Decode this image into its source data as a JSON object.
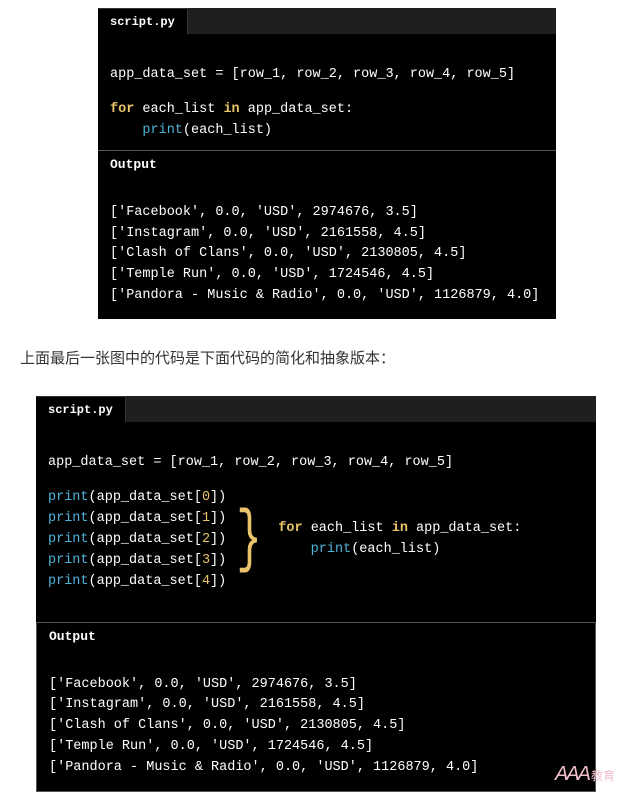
{
  "script_tab": "script.py",
  "assign_line": "app_data_set = [row_1, row_2, row_3, row_4, row_5]",
  "for_kw": "for",
  "in_kw": "in",
  "loop_var": "each_list",
  "loop_iter": "app_data_set:",
  "print_fn": "print",
  "loop_body_arg": "(each_list)",
  "output_label": "Output",
  "output_lines": [
    "['Facebook', 0.0, 'USD', 2974676, 3.5]",
    "['Instagram', 0.0, 'USD', 2161558, 4.5]",
    "['Clash of Clans', 0.0, 'USD', 2130805, 4.5]",
    "['Temple Run', 0.0, 'USD', 1724546, 4.5]",
    "['Pandora - Music & Radio', 0.0, 'USD', 1126879, 4.0]"
  ],
  "paragraph": "上面最后一张图中的代码是下面代码的简化和抽象版本：",
  "expanded_prints": [
    {
      "pre": "(app_data_set[",
      "idx": "0",
      "post": "])"
    },
    {
      "pre": "(app_data_set[",
      "idx": "1",
      "post": "])"
    },
    {
      "pre": "(app_data_set[",
      "idx": "2",
      "post": "])"
    },
    {
      "pre": "(app_data_set[",
      "idx": "3",
      "post": "])"
    },
    {
      "pre": "(app_data_set[",
      "idx": "4",
      "post": "])"
    }
  ],
  "watermark_main": "AAA",
  "watermark_small": "教育"
}
